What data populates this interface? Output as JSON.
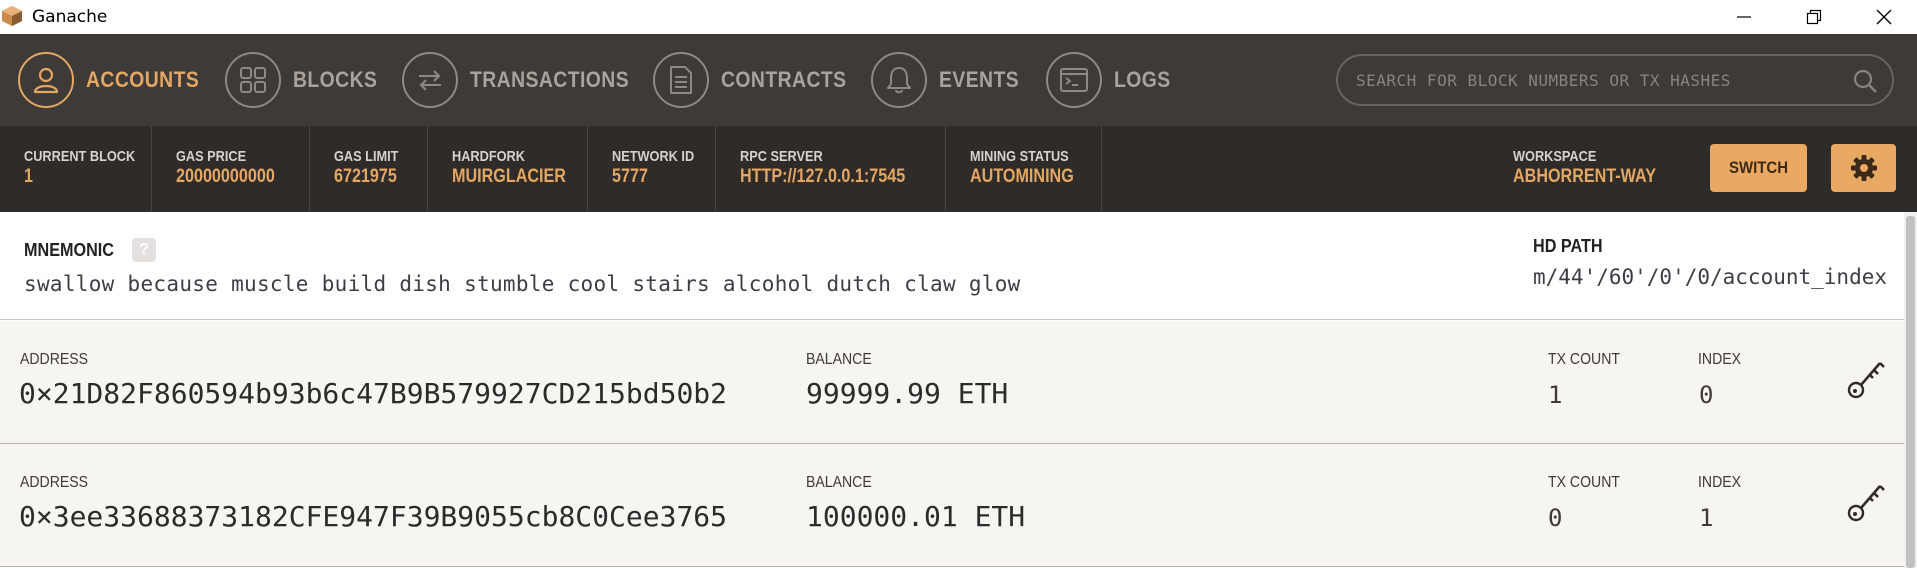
{
  "window": {
    "title": "Ganache",
    "icons": {
      "app": "ganache-logo-icon",
      "minimize": "minimize-icon",
      "restore": "restore-icon",
      "close": "close-icon"
    }
  },
  "nav": {
    "items": [
      {
        "label": "ACCOUNTS",
        "icon": "person-icon",
        "active": true
      },
      {
        "label": "BLOCKS",
        "icon": "grid-icon",
        "active": false
      },
      {
        "label": "TRANSACTIONS",
        "icon": "arrows-icon",
        "active": false
      },
      {
        "label": "CONTRACTS",
        "icon": "document-icon",
        "active": false
      },
      {
        "label": "EVENTS",
        "icon": "bell-icon",
        "active": false
      },
      {
        "label": "LOGS",
        "icon": "terminal-icon",
        "active": false
      }
    ],
    "search_placeholder": "SEARCH FOR BLOCK NUMBERS OR TX HASHES"
  },
  "status": {
    "items": [
      {
        "label": "CURRENT BLOCK",
        "value": "1"
      },
      {
        "label": "GAS PRICE",
        "value": "20000000000"
      },
      {
        "label": "GAS LIMIT",
        "value": "6721975"
      },
      {
        "label": "HARDFORK",
        "value": "MUIRGLACIER"
      },
      {
        "label": "NETWORK ID",
        "value": "5777"
      },
      {
        "label": "RPC SERVER",
        "value": "HTTP://127.0.0.1:7545"
      },
      {
        "label": "MINING STATUS",
        "value": "AUTOMINING"
      }
    ],
    "workspace_label": "WORKSPACE",
    "workspace_value": "ABHORRENT-WAY",
    "switch_label": "SWITCH"
  },
  "mnemonic": {
    "label": "MNEMONIC",
    "help": "?",
    "phrase": "swallow because muscle build dish stumble cool stairs alcohol dutch claw glow",
    "hd_path_label": "HD PATH",
    "hd_path": "m/44'/60'/0'/0/account_index"
  },
  "accounts": [
    {
      "address_label": "ADDRESS",
      "address": "0×21D82F860594b93b6c47B9B579927CD215bd50b2",
      "balance_label": "BALANCE",
      "balance": "99999.99 ETH",
      "tx_count_label": "TX COUNT",
      "tx_count": "1",
      "index_label": "INDEX",
      "index": "0"
    },
    {
      "address_label": "ADDRESS",
      "address": "0×3ee33688373182CFE947F39B9055cb8C0Cee3765",
      "balance_label": "BALANCE",
      "balance": "100000.01 ETH",
      "tx_count_label": "TX COUNT",
      "tx_count": "0",
      "index_label": "INDEX",
      "index": "1"
    }
  ],
  "colors": {
    "accent": "#e4a663",
    "nav_bg": "#3e3a37",
    "status_bg": "#2f2b29",
    "row_bg": "#f7f5f0"
  }
}
